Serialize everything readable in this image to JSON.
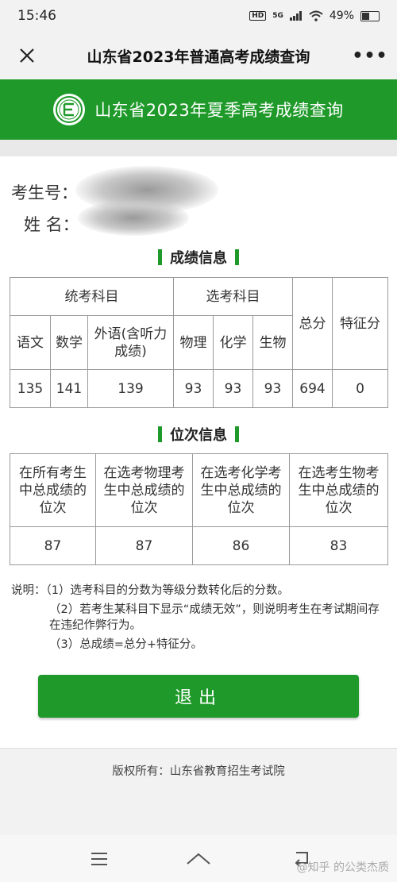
{
  "status": {
    "time": "15:46",
    "hd": "HD",
    "signal": "5G",
    "battery": "49%",
    "battery_level": 0.49
  },
  "nav": {
    "title": "山东省2023年普通高考成绩查询",
    "more": "•••"
  },
  "banner": {
    "title": "山东省2023年夏季高考成绩查询"
  },
  "candidate": {
    "id_label": "考生号：",
    "name_label": "姓  名："
  },
  "scores": {
    "section_title": "成绩信息",
    "group_unified": "统考科目",
    "group_elective": "选考科目",
    "total_label": "总分",
    "bonus_label": "特征分",
    "subjects": [
      "语文",
      "数学",
      "外语(含听力成绩)",
      "物理",
      "化学",
      "生物"
    ],
    "values": [
      "135",
      "141",
      "139",
      "93",
      "93",
      "93",
      "694",
      "0"
    ]
  },
  "ranks": {
    "section_title": "位次信息",
    "headers": [
      "在所有考生中总成绩的位次",
      "在选考物理考生中总成绩的位次",
      "在选考化学考生中总成绩的位次",
      "在选考生物考生中总成绩的位次"
    ],
    "values": [
      "87",
      "87",
      "86",
      "83"
    ]
  },
  "notes": {
    "label": "说明：",
    "items": [
      "（1）选考科目的分数为等级分数转化后的分数。",
      "（2）若考生某科目下显示“成绩无效”，则说明考生在考试期间存在违纪作弊行为。",
      "（3）总成绩=总分+特征分。"
    ]
  },
  "exit_label": "退出",
  "footer": "版权所有：山东省教育招生考试院",
  "watermark": "@知乎 的公类杰质",
  "colors": {
    "brand_green": "#1f9a2a"
  }
}
